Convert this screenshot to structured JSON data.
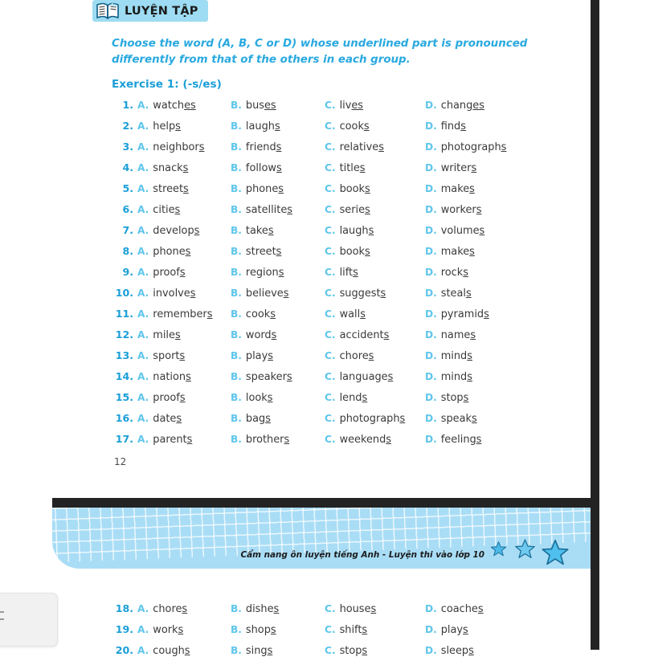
{
  "badge": {
    "label": "LUYỆN TẬP",
    "icon": "open-book-icon",
    "background": "#9ddcf2"
  },
  "instruction": "Choose the word (A, B, C or D) whose underlined part is pronounced differently from that of the others in each group.",
  "exercise": {
    "title": "Exercise 1: (-s/es)"
  },
  "page_number": "12",
  "colors": {
    "heading_blue": "#29a9e0",
    "number_blue": "#1b9fd8",
    "letter_blue": "#5fc6ec",
    "word_gray": "#3a3a3a",
    "band_blue": "#a9ddf6",
    "dark_bar": "#232323"
  },
  "option_letters": [
    "A.",
    "B.",
    "C.",
    "D."
  ],
  "questions": [
    {
      "num": "1.",
      "a": {
        "stem": "watch",
        "underline": "es",
        "tail": ""
      },
      "b": {
        "stem": "bus",
        "underline": "es",
        "tail": ""
      },
      "c": {
        "stem": "liv",
        "underline": "es",
        "tail": ""
      },
      "d": {
        "stem": "chang",
        "underline": "es",
        "tail": ""
      }
    },
    {
      "num": "2.",
      "a": {
        "stem": "help",
        "underline": "s",
        "tail": ""
      },
      "b": {
        "stem": "laugh",
        "underline": "s",
        "tail": ""
      },
      "c": {
        "stem": "cook",
        "underline": "s",
        "tail": ""
      },
      "d": {
        "stem": "find",
        "underline": "s",
        "tail": ""
      }
    },
    {
      "num": "3.",
      "a": {
        "stem": "neighbor",
        "underline": "s",
        "tail": ""
      },
      "b": {
        "stem": "friend",
        "underline": "s",
        "tail": ""
      },
      "c": {
        "stem": "relative",
        "underline": "s",
        "tail": ""
      },
      "d": {
        "stem": "photograph",
        "underline": "s",
        "tail": ""
      }
    },
    {
      "num": "4.",
      "a": {
        "stem": "snack",
        "underline": "s",
        "tail": ""
      },
      "b": {
        "stem": "follow",
        "underline": "s",
        "tail": ""
      },
      "c": {
        "stem": "title",
        "underline": "s",
        "tail": ""
      },
      "d": {
        "stem": "writer",
        "underline": "s",
        "tail": ""
      }
    },
    {
      "num": "5.",
      "a": {
        "stem": "street",
        "underline": "s",
        "tail": ""
      },
      "b": {
        "stem": "phone",
        "underline": "s",
        "tail": ""
      },
      "c": {
        "stem": "book",
        "underline": "s",
        "tail": ""
      },
      "d": {
        "stem": "make",
        "underline": "s",
        "tail": ""
      }
    },
    {
      "num": "6.",
      "a": {
        "stem": "citie",
        "underline": "s",
        "tail": ""
      },
      "b": {
        "stem": "satellite",
        "underline": "s",
        "tail": ""
      },
      "c": {
        "stem": "serie",
        "underline": "s",
        "tail": ""
      },
      "d": {
        "stem": "worker",
        "underline": "s",
        "tail": ""
      }
    },
    {
      "num": "7.",
      "a": {
        "stem": "develop",
        "underline": "s",
        "tail": ""
      },
      "b": {
        "stem": "take",
        "underline": "s",
        "tail": ""
      },
      "c": {
        "stem": "laugh",
        "underline": "s",
        "tail": ""
      },
      "d": {
        "stem": "volume",
        "underline": "s",
        "tail": ""
      }
    },
    {
      "num": "8.",
      "a": {
        "stem": "phone",
        "underline": "s",
        "tail": ""
      },
      "b": {
        "stem": "street",
        "underline": "s",
        "tail": ""
      },
      "c": {
        "stem": "book",
        "underline": "s",
        "tail": ""
      },
      "d": {
        "stem": "make",
        "underline": "s",
        "tail": ""
      }
    },
    {
      "num": "9.",
      "a": {
        "stem": "proof",
        "underline": "s",
        "tail": ""
      },
      "b": {
        "stem": "region",
        "underline": "s",
        "tail": ""
      },
      "c": {
        "stem": "lift",
        "underline": "s",
        "tail": ""
      },
      "d": {
        "stem": "rock",
        "underline": "s",
        "tail": ""
      }
    },
    {
      "num": "10.",
      "a": {
        "stem": "involve",
        "underline": "s",
        "tail": ""
      },
      "b": {
        "stem": "believe",
        "underline": "s",
        "tail": ""
      },
      "c": {
        "stem": "suggest",
        "underline": "s",
        "tail": ""
      },
      "d": {
        "stem": "steal",
        "underline": "s",
        "tail": ""
      }
    },
    {
      "num": "11.",
      "a": {
        "stem": "remember",
        "underline": "s",
        "tail": ""
      },
      "b": {
        "stem": "cook",
        "underline": "s",
        "tail": ""
      },
      "c": {
        "stem": "wall",
        "underline": "s",
        "tail": ""
      },
      "d": {
        "stem": "pyramid",
        "underline": "s",
        "tail": ""
      }
    },
    {
      "num": "12.",
      "a": {
        "stem": "mile",
        "underline": "s",
        "tail": ""
      },
      "b": {
        "stem": "word",
        "underline": "s",
        "tail": ""
      },
      "c": {
        "stem": "accident",
        "underline": "s",
        "tail": ""
      },
      "d": {
        "stem": "name",
        "underline": "s",
        "tail": ""
      }
    },
    {
      "num": "13.",
      "a": {
        "stem": "sport",
        "underline": "s",
        "tail": ""
      },
      "b": {
        "stem": "play",
        "underline": "s",
        "tail": ""
      },
      "c": {
        "stem": "chore",
        "underline": "s",
        "tail": ""
      },
      "d": {
        "stem": "mind",
        "underline": "s",
        "tail": ""
      }
    },
    {
      "num": "14.",
      "a": {
        "stem": "nation",
        "underline": "s",
        "tail": ""
      },
      "b": {
        "stem": "speaker",
        "underline": "s",
        "tail": ""
      },
      "c": {
        "stem": "language",
        "underline": "s",
        "tail": ""
      },
      "d": {
        "stem": "mind",
        "underline": "s",
        "tail": ""
      }
    },
    {
      "num": "15.",
      "a": {
        "stem": "proof",
        "underline": "s",
        "tail": ""
      },
      "b": {
        "stem": "look",
        "underline": "s",
        "tail": ""
      },
      "c": {
        "stem": "lend",
        "underline": "s",
        "tail": ""
      },
      "d": {
        "stem": "stop",
        "underline": "s",
        "tail": ""
      }
    },
    {
      "num": "16.",
      "a": {
        "stem": "date",
        "underline": "s",
        "tail": ""
      },
      "b": {
        "stem": "bag",
        "underline": "s",
        "tail": ""
      },
      "c": {
        "stem": "photograph",
        "underline": "s",
        "tail": ""
      },
      "d": {
        "stem": "speak",
        "underline": "s",
        "tail": ""
      }
    },
    {
      "num": "17.",
      "a": {
        "stem": "parent",
        "underline": "s",
        "tail": ""
      },
      "b": {
        "stem": "brother",
        "underline": "s",
        "tail": ""
      },
      "c": {
        "stem": "weekend",
        "underline": "s",
        "tail": ""
      },
      "d": {
        "stem": "feeling",
        "underline": "s",
        "tail": ""
      }
    }
  ],
  "footer": {
    "caption": "Cẩm nang ôn luyện tiếng Anh - Luyện thi vào lớp 10",
    "stars": 3
  },
  "next_page": {
    "questions": [
      {
        "num": "18.",
        "a": {
          "stem": "chore",
          "underline": "s",
          "tail": ""
        },
        "b": {
          "stem": "dishe",
          "underline": "s",
          "tail": ""
        },
        "c": {
          "stem": "house",
          "underline": "s",
          "tail": ""
        },
        "d": {
          "stem": "coache",
          "underline": "s",
          "tail": ""
        }
      },
      {
        "num": "19.",
        "a": {
          "stem": "work",
          "underline": "s",
          "tail": ""
        },
        "b": {
          "stem": "shop",
          "underline": "s",
          "tail": ""
        },
        "c": {
          "stem": "shift",
          "underline": "s",
          "tail": ""
        },
        "d": {
          "stem": "play",
          "underline": "s",
          "tail": ""
        }
      },
      {
        "num": "20.",
        "a": {
          "stem": "cough",
          "underline": "s",
          "tail": ""
        },
        "b": {
          "stem": "sing",
          "underline": "s",
          "tail": ""
        },
        "c": {
          "stem": "stop",
          "underline": "s",
          "tail": ""
        },
        "d": {
          "stem": "sleep",
          "underline": "s",
          "tail": ""
        }
      }
    ]
  }
}
